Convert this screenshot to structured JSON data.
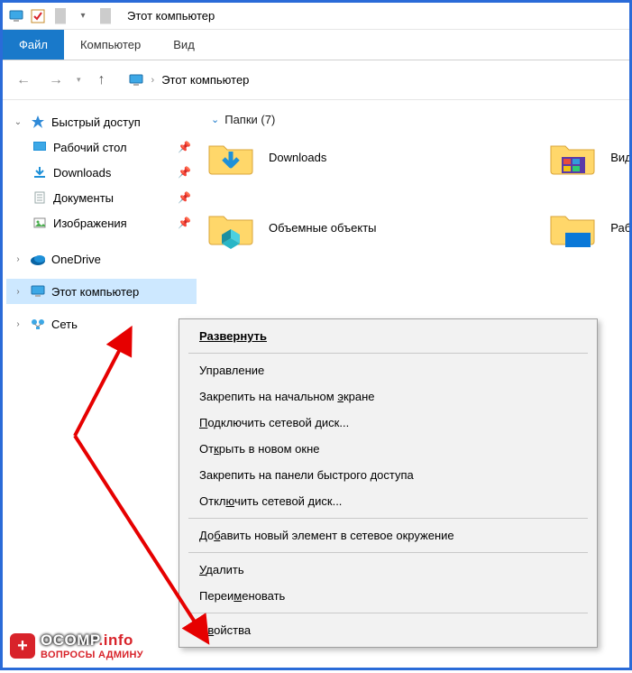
{
  "window": {
    "title": "Этот компьютер"
  },
  "ribbon": {
    "tabs": [
      {
        "label": "Файл",
        "kind": "file"
      },
      {
        "label": "Компьютер",
        "kind": "normal"
      },
      {
        "label": "Вид",
        "kind": "normal"
      }
    ]
  },
  "breadcrumb": {
    "root": "Этот компьютер"
  },
  "sidebar": {
    "items": [
      {
        "label": "Быстрый доступ",
        "icon": "star-icon",
        "chev": "down",
        "level": 0
      },
      {
        "label": "Рабочий стол",
        "icon": "desktop-icon",
        "level": 1,
        "pinned": true
      },
      {
        "label": "Downloads",
        "icon": "downloads-icon",
        "level": 1,
        "pinned": true
      },
      {
        "label": "Документы",
        "icon": "documents-icon",
        "level": 1,
        "pinned": true
      },
      {
        "label": "Изображения",
        "icon": "images-icon",
        "level": 1,
        "pinned": true
      },
      {
        "label": "OneDrive",
        "icon": "onedrive-icon",
        "chev": "right",
        "level": 0
      },
      {
        "label": "Этот компьютер",
        "icon": "computer-icon",
        "chev": "right",
        "level": 0,
        "selected": true
      },
      {
        "label": "Сеть",
        "icon": "network-icon",
        "chev": "right",
        "level": 0
      }
    ]
  },
  "content": {
    "section_header": "Папки (7)",
    "folders_left": [
      {
        "label": "Downloads",
        "icon": "downloads-folder-icon"
      },
      {
        "label": "Объемные объекты",
        "icon": "3dobjects-folder-icon"
      }
    ],
    "folders_right": [
      {
        "label": "Виде",
        "icon": "videos-folder-icon"
      },
      {
        "label": "Рабо",
        "icon": "desktop-folder-icon"
      }
    ]
  },
  "context_menu": {
    "items": [
      {
        "text": "Развернуть",
        "bold": true,
        "ul_index": 0
      },
      {
        "sep": true
      },
      {
        "text": "Управление"
      },
      {
        "text": "Закрепить на начальном экране",
        "ul_at": "э"
      },
      {
        "text": "Подключить сетевой диск...",
        "ul_at": "П"
      },
      {
        "text": "Открыть в новом окне",
        "ul_at": "к"
      },
      {
        "text": "Закрепить на панели быстрого доступа"
      },
      {
        "text": "Отключить сетевой диск...",
        "ul_at": "ю"
      },
      {
        "sep": true
      },
      {
        "text": "Добавить новый элемент в сетевое окружение",
        "ul_at": "б"
      },
      {
        "sep": true
      },
      {
        "text": "Удалить",
        "ul_at": "У"
      },
      {
        "text": "Переименовать",
        "ul_at": "м"
      },
      {
        "sep": true
      },
      {
        "text": "Свойства",
        "ul_at": "в"
      }
    ]
  },
  "watermark": {
    "brand": "OCOMP",
    "suffix": ".info",
    "subtitle": "ВОПРОСЫ АДМИНУ"
  }
}
